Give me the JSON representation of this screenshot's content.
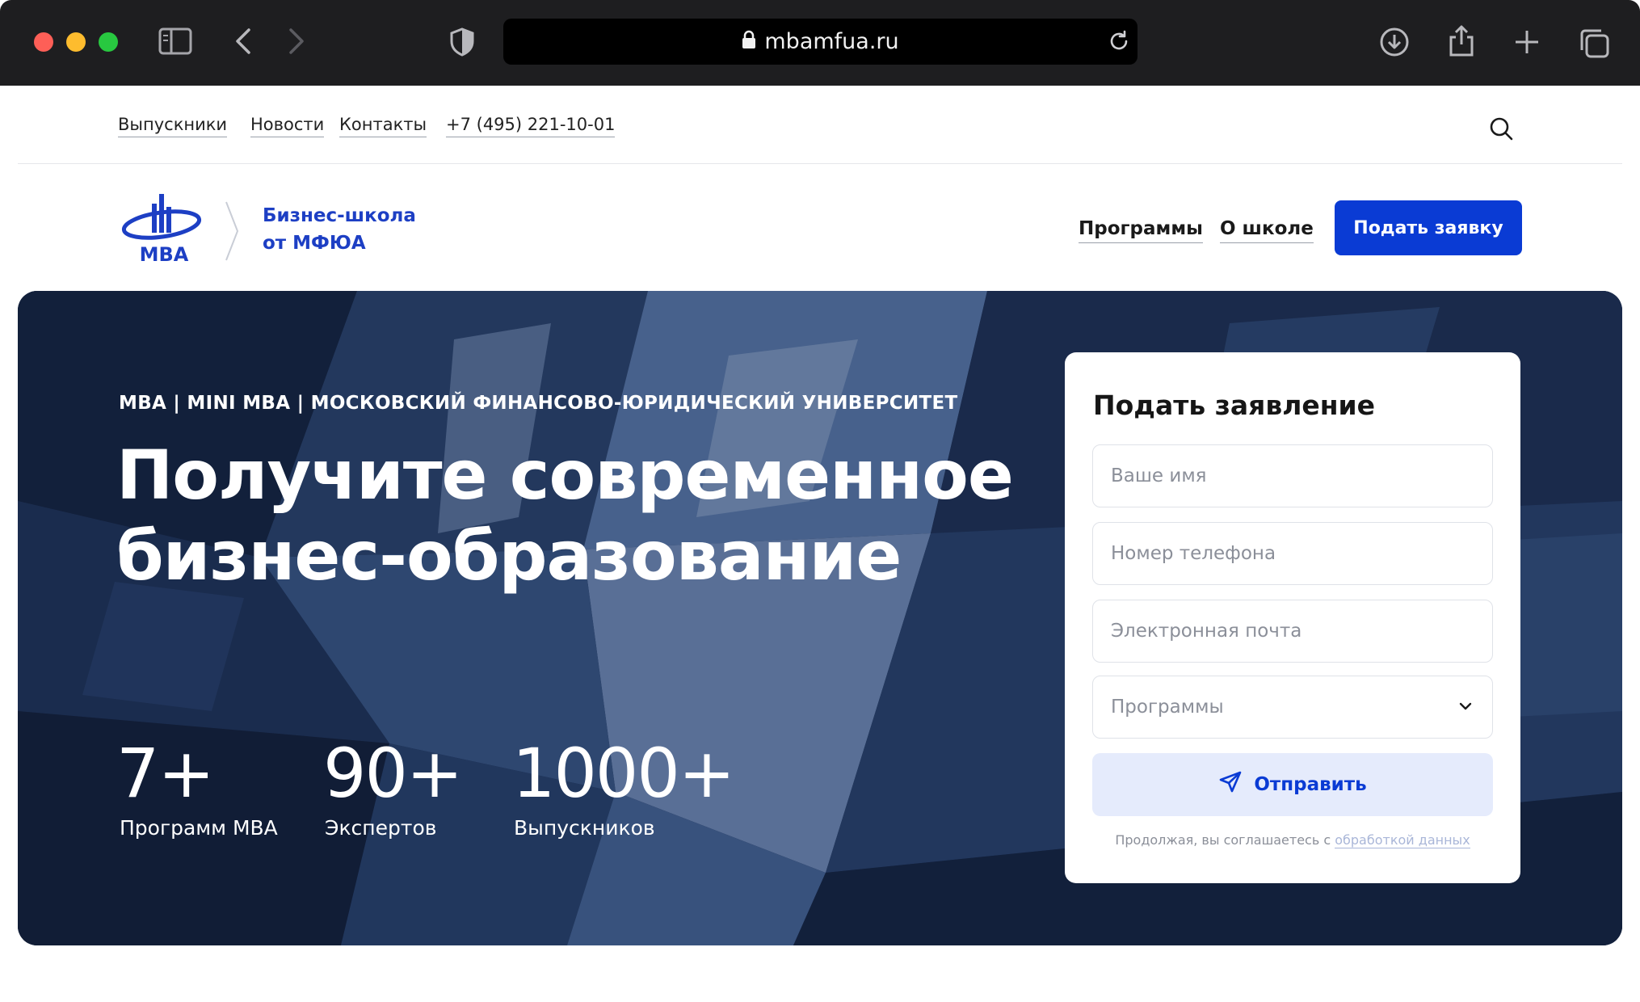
{
  "browser": {
    "url": "mbamfua.ru"
  },
  "topnav": {
    "items": [
      "Выпускники",
      "Новости",
      "Контакты"
    ],
    "phone": "+7 (495) 221-10-01"
  },
  "header": {
    "logo_label": "MBA",
    "school_line1": "Бизнес-школа",
    "school_line2": "от МФЮА",
    "nav": [
      "Программы",
      "О школе"
    ],
    "apply_label": "Подать заявку"
  },
  "hero": {
    "eyebrow": "MBA | MINI MBA | МОСКОВСКИЙ ФИНАНСОВО-ЮРИДИЧЕСКИЙ УНИВЕРСИТЕТ",
    "headline_line1": "Получите современное",
    "headline_line2": "бизнес-образование",
    "stats": [
      {
        "value": "7+",
        "label": "Программ MBA"
      },
      {
        "value": "90+",
        "label": "Экспертов"
      },
      {
        "value": "1000+",
        "label": "Выпускников"
      }
    ]
  },
  "form": {
    "title": "Подать заявление",
    "name_placeholder": "Ваше имя",
    "phone_placeholder": "Номер телефона",
    "email_placeholder": "Электронная почта",
    "program_select": "Программы",
    "submit_label": "Отправить",
    "consent_text": "Продолжая, вы соглашаетесь с ",
    "consent_link": "обработкой данных"
  },
  "colors": {
    "brand_blue": "#0a3bd4",
    "chrome_bg": "#1e1e20",
    "hero_bg": "#1c2b49"
  }
}
